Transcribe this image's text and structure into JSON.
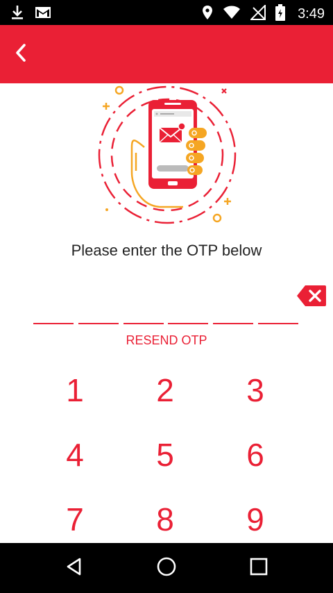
{
  "status_bar": {
    "time": "3:49",
    "icons": [
      "download-icon",
      "gmail-icon",
      "location-icon",
      "wifi-icon",
      "no-signal-icon",
      "battery-icon"
    ]
  },
  "app_bar": {
    "back_icon": "chevron-left-icon",
    "color": "#ea2035"
  },
  "otp": {
    "prompt": "Please enter the OTP below",
    "digit_count": 6,
    "digits": [
      "",
      "",
      "",
      "",
      "",
      ""
    ],
    "resend_label": "RESEND OTP",
    "clear_icon": "backspace-icon"
  },
  "keypad": {
    "keys": [
      "1",
      "2",
      "3",
      "4",
      "5",
      "6",
      "7",
      "8",
      "9"
    ]
  },
  "nav_bar": {
    "icons": [
      "back-triangle-icon",
      "home-circle-icon",
      "recents-square-icon"
    ]
  },
  "colors": {
    "accent": "#ea2035",
    "secondary": "#f5a623",
    "text": "#222222"
  }
}
